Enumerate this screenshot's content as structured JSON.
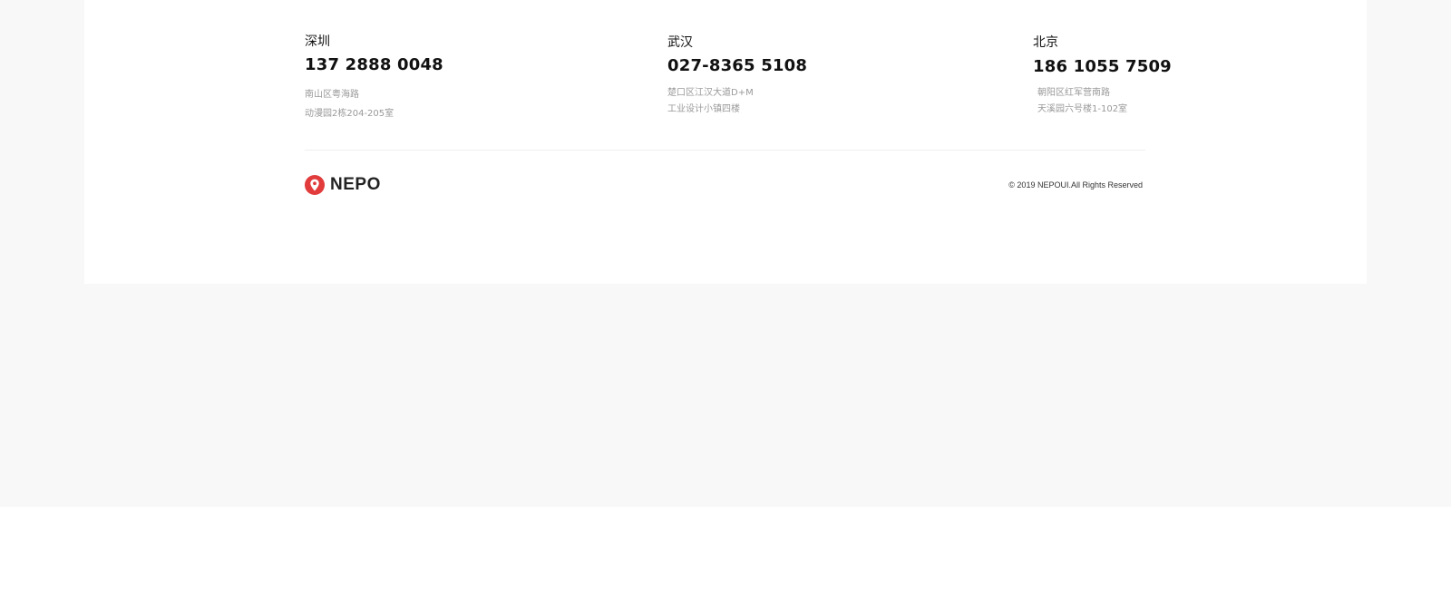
{
  "offices": [
    {
      "city": "深圳",
      "phone": "137 2888 0048",
      "address_line1": "南山区粤海路",
      "address_line2": "动漫园2栋204-205室"
    },
    {
      "city": "武汉",
      "phone": "027-8365 5108",
      "address_line1": "楚口区江汉大道D+M",
      "address_line2": "工业设计小镇四楼"
    },
    {
      "city": "北京",
      "phone": "186 1055 7509",
      "address_line1": "朝阳区红军营南路",
      "address_line2": "天溪园六号楼1-102室"
    }
  ],
  "brand": {
    "name": "NEPO",
    "logo_icon": "location-pin-icon",
    "logo_color": "#e23b3b"
  },
  "copyright": "© 2019 NEPOUI.All Rights Reserved",
  "colors": {
    "page_background": "#f8f8f8",
    "card_background": "#ffffff",
    "muted_text": "#999999"
  }
}
